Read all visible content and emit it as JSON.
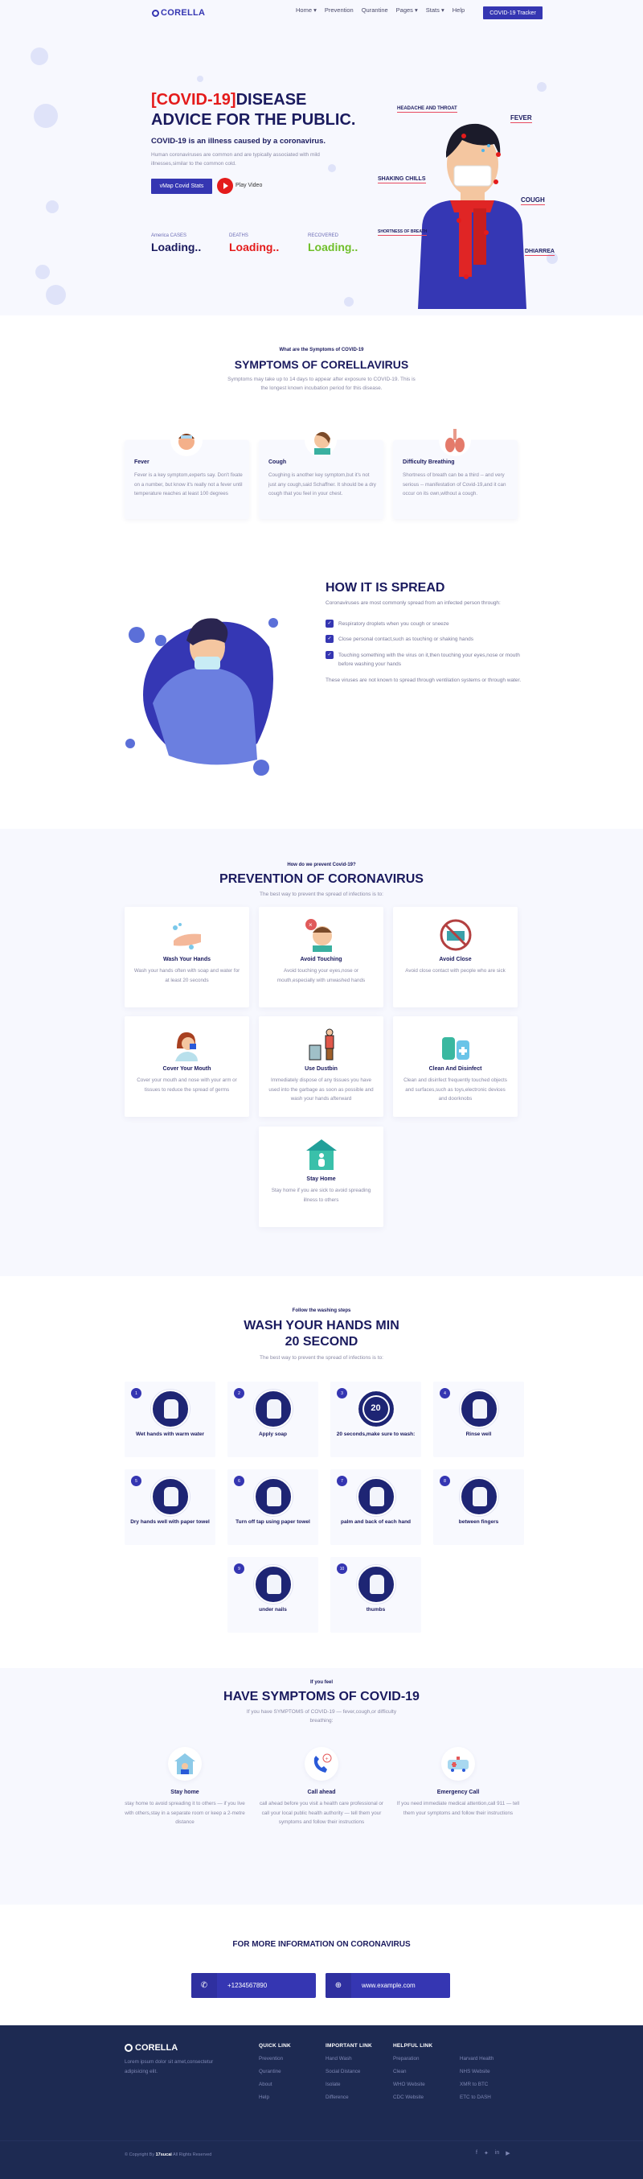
{
  "nav": {
    "brand": "CORELLA",
    "items": [
      {
        "label": "Home ▾"
      },
      {
        "label": "Prevention"
      },
      {
        "label": "Qurantine"
      },
      {
        "label": "Pages ▾"
      },
      {
        "label": "Stats ▾"
      },
      {
        "label": "Help"
      }
    ],
    "cta": "COVID-19 Tracker"
  },
  "hero": {
    "title_red": "[COVID-19]",
    "title_rest": "DISEASE",
    "title_line2": "ADVICE FOR THE PUBLIC.",
    "subtitle": "COVID-19 is an illness caused by a coronavirus.",
    "description": "Human coronaviruses are common and are typically associated with mild illnesses,similar to the common cold.",
    "primary_button": "vMap Covid Stats",
    "play_label": "Play Video",
    "stats": [
      {
        "label": "America CASES",
        "value": "Loading..",
        "color": "#1a1a5e"
      },
      {
        "label": "DEATHS",
        "value": "Loading..",
        "color": "#e41b1b"
      },
      {
        "label": "RECOVERED",
        "value": "Loading..",
        "color": "#6fbf2a"
      }
    ],
    "callouts": {
      "headache": "HEADACHE AND THROAT",
      "fever": "FEVER",
      "chills": "SHAKING CHILLS",
      "cough": "COUGH",
      "breath": "SHORTNESS OF BREATH",
      "diarrhea": "DHIARREA"
    }
  },
  "symptoms": {
    "kicker": "What are the Symptoms of COVID-19",
    "title": "SYMPTOMS OF CORELLAVIRUS",
    "description": "Symptoms may take up to 14 days to appear after exposure to COVID-19. This is the longest known incubation period for this disease.",
    "cards": [
      {
        "title": "Fever",
        "text": "Fever is a key symptom,experts say. Don't fixate on a number, but know it's really not a fever until temperature reaches at least 100 degrees"
      },
      {
        "title": "Cough",
        "text": "Coughing is another key symptom,but it's not just any cough,said Schaffner. It should be a dry cough that you feel in your chest."
      },
      {
        "title": "Difficulty Breathing",
        "text": "Shortness of breath can be a third -- and very serious -- manifestation of Covid-19,and it can occur on its own,without a cough."
      }
    ]
  },
  "spread": {
    "title": "HOW IT IS SPREAD",
    "intro": "Coronaviruses are most commonly spread from an infected person through:",
    "items": [
      "Respiratory droplets when you cough or sneeze",
      "Close personal contact,such as touching or shaking hands",
      "Touching something with the virus on it,then touching your eyes,nose or mouth before washing your hands"
    ],
    "note": "These viruses are not known to spread through ventilation systems or through water."
  },
  "prevention": {
    "kicker": "How do we prevent Covid-19?",
    "title": "PREVENTION OF CORONAVIRUS",
    "description": "The best way to prevent the spread of infections is to:",
    "cards": [
      {
        "title": "Wash Your Hands",
        "text": "Wash your hands often with soap and water for at least 20 seconds"
      },
      {
        "title": "Avoid Touching",
        "text": "Avoid touching your eyes,nose or mouth,especially with unwashed hands"
      },
      {
        "title": "Avoid Close",
        "text": "Avoid close contact with people who are sick"
      },
      {
        "title": "Cover Your Mouth",
        "text": "Cover your mouth and nose with your arm or tissues to reduce the spread of germs"
      },
      {
        "title": "Use Dustbin",
        "text": "Immediately dispose of any tissues you have used into the garbage as soon as possible and wash your hands afterward"
      },
      {
        "title": "Clean And Disinfect",
        "text": "Clean and disinfect frequently touched objects and surfaces,such as toys,electronic devices and doorknobs"
      },
      {
        "title": "Stay Home",
        "text": "Stay home if you are sick to avoid spreading illness to others"
      }
    ]
  },
  "wash": {
    "kicker": "Follow the washing steps",
    "title": "WASH YOUR HANDS MIN 20 SECOND",
    "description": "The best way to prevent the spread of infections is to:",
    "timer_label": "20",
    "steps": [
      {
        "num": "1",
        "label": "Wet hands with warm water"
      },
      {
        "num": "2",
        "label": "Apply soap"
      },
      {
        "num": "3",
        "label": "20 seconds,make sure to wash:"
      },
      {
        "num": "4",
        "label": "Rinse well"
      },
      {
        "num": "5",
        "label": "Dry hands well with paper towel"
      },
      {
        "num": "6",
        "label": "Turn off tap using paper towel"
      },
      {
        "num": "7",
        "label": "palm and back of each hand"
      },
      {
        "num": "8",
        "label": "between fingers"
      },
      {
        "num": "9",
        "label": "under nails"
      },
      {
        "num": "10",
        "label": "thumbs"
      }
    ]
  },
  "have_symptoms": {
    "kicker": "If you feel",
    "title": "HAVE SYMPTOMS OF COVID-19",
    "description": "If you have SYMPTOMS of COVID-19 — fever,cough,or difficulty breathing:",
    "items": [
      {
        "title": "Stay home",
        "text": "stay home to avoid spreading it to others — if you live with others,stay in a separate room or keep a 2-metre distance"
      },
      {
        "title": "Call ahead",
        "text": "call ahead before you visit a health care professional or call your local public health authority — tell them your symptoms and follow their instructions"
      },
      {
        "title": "Emergency Call",
        "text": "If you need immediate medical attention,call 911 — tell them your symptoms and follow their instructions"
      }
    ]
  },
  "more_info": {
    "title": "FOR MORE INFORMATION ON CORONAVIRUS",
    "phone": "+1234567890",
    "website": "www.example.com"
  },
  "footer": {
    "brand": "CORELLA",
    "about": "Lorem ipsum dolor sit amet,consectetur adipisicing elit.",
    "columns": [
      {
        "title": "QUICK LINK",
        "links": [
          "Prevention",
          "Qurantine",
          "About",
          "Help"
        ]
      },
      {
        "title": "IMPORTANT LINK",
        "links": [
          "Hand Wash",
          "Social Distance",
          "Isolate",
          "Difference"
        ]
      },
      {
        "title": "HELPFUL LINK",
        "links": [
          "Preparation",
          "Clean",
          "WHO Website",
          "CDC Website"
        ]
      },
      {
        "title": "",
        "links": [
          "Harvard Health",
          "NHS Website",
          "XMR to BTC",
          "ETC to DASH"
        ]
      }
    ],
    "copyright_prefix": "© Copyright By ",
    "copyright_brand": "17sucai",
    "copyright_suffix": " All Rights Reserved",
    "social": [
      "f",
      "t",
      "in",
      "yt"
    ]
  },
  "colors": {
    "brand": "#3536b2",
    "navy": "#1a1a5e",
    "red": "#e41b1b",
    "green": "#6fbf2a",
    "footer": "#1d2a52"
  }
}
